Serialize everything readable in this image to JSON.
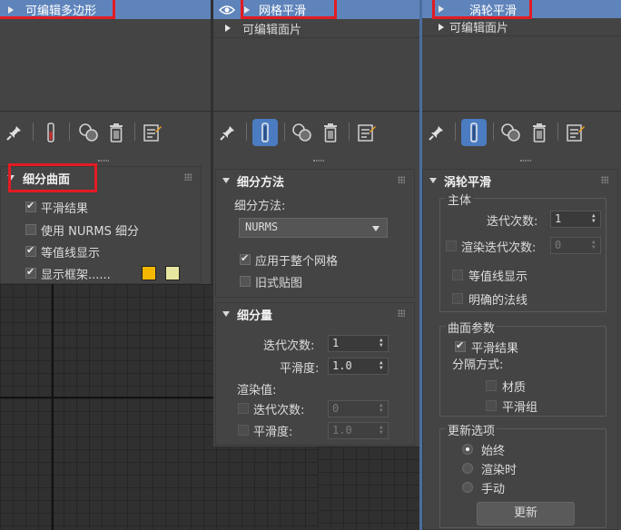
{
  "panel_left": {
    "stack": [
      {
        "label": "可编辑多边形",
        "selected": true
      }
    ],
    "rollout": {
      "title": "细分曲面",
      "options": [
        {
          "label": "平滑结果",
          "checked": true
        },
        {
          "label": "使用 NURMS 细分",
          "checked": false
        },
        {
          "label": "等值线显示",
          "checked": true
        },
        {
          "label": "显示框架......",
          "checked": true
        }
      ],
      "swatch_colors": [
        "#f5b800",
        "#e6e6a0"
      ]
    }
  },
  "panel_middle": {
    "stack": [
      {
        "label": "网格平滑",
        "selected": true
      },
      {
        "label": "可编辑面片",
        "selected": false
      }
    ],
    "subdivision_method": {
      "title": "细分方法",
      "method_label": "细分方法:",
      "method_value": "NURMS",
      "apply_to_whole_mesh": "应用于整个网格",
      "old_style_mapping": "旧式贴图"
    },
    "subdivision_amount": {
      "title": "细分量",
      "iterations_label": "迭代次数:",
      "iterations_value": "1",
      "smoothness_label": "平滑度:",
      "smoothness_value": "1.0",
      "render_values_label": "渲染值:",
      "render_iterations_label": "迭代次数:",
      "render_iterations_value": "0",
      "render_smoothness_label": "平滑度:",
      "render_smoothness_value": "1.0"
    }
  },
  "panel_right": {
    "stack": [
      {
        "label": "涡轮平滑",
        "selected": true
      },
      {
        "label": "可编辑面片",
        "selected": false
      }
    ],
    "turbosmooth": {
      "title": "涡轮平滑",
      "main_group": "主体",
      "iterations_label": "迭代次数:",
      "iterations_value": "1",
      "render_iters_label": "渲染迭代次数:",
      "render_iters_value": "0",
      "isoline_display": "等值线显示",
      "explicit_normals": "明确的法线",
      "surface_group": "曲面参数",
      "smooth_result": "平滑结果",
      "separate_by": "分隔方式:",
      "materials": "材质",
      "smoothing_groups": "平滑组",
      "update_group": "更新选项",
      "always": "始终",
      "when_rendering": "渲染时",
      "manually": "手动",
      "update_button": "更新"
    }
  },
  "colors": {
    "accent": "#5f84bb",
    "highlight_box": "#e31b23",
    "panel_bg": "#444444"
  }
}
